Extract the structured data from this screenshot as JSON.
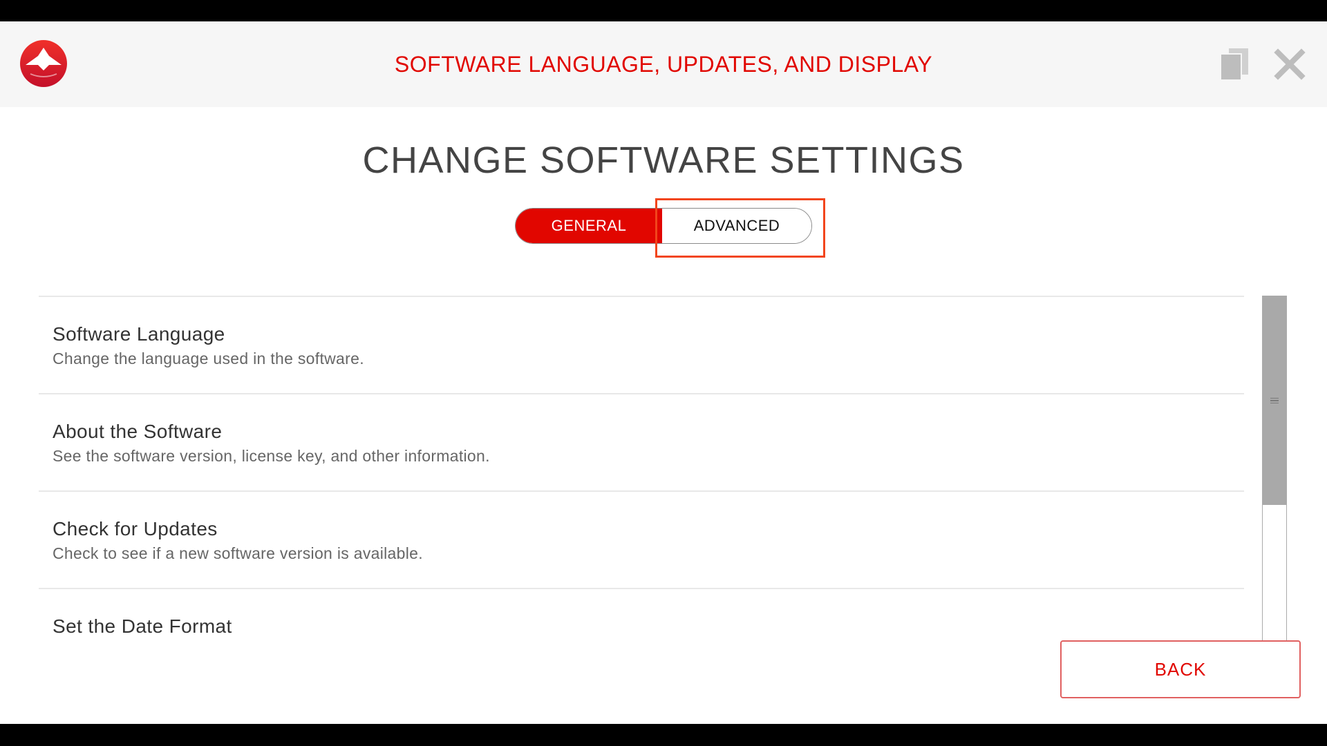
{
  "header": {
    "title": "SOFTWARE LANGUAGE, UPDATES, AND DISPLAY",
    "logo_icon": "brand-logo-icon",
    "copy_icon": "copy-icon",
    "close_icon": "close-icon"
  },
  "page": {
    "title": "CHANGE SOFTWARE SETTINGS"
  },
  "tabs": [
    {
      "label": "GENERAL",
      "active": true
    },
    {
      "label": "ADVANCED",
      "active": false
    }
  ],
  "settings": [
    {
      "title": "Software Language",
      "description": "Change the language used in the software."
    },
    {
      "title": "About the Software",
      "description": "See the software version, license key, and other information."
    },
    {
      "title": "Check for Updates",
      "description": "Check to see if a new software version is available."
    },
    {
      "title": "Set the Date Format",
      "description": ""
    }
  ],
  "footer": {
    "back_label": "BACK"
  },
  "colors": {
    "accent": "#e10600",
    "highlight": "#f2451c",
    "header_bg": "#f6f6f6"
  }
}
